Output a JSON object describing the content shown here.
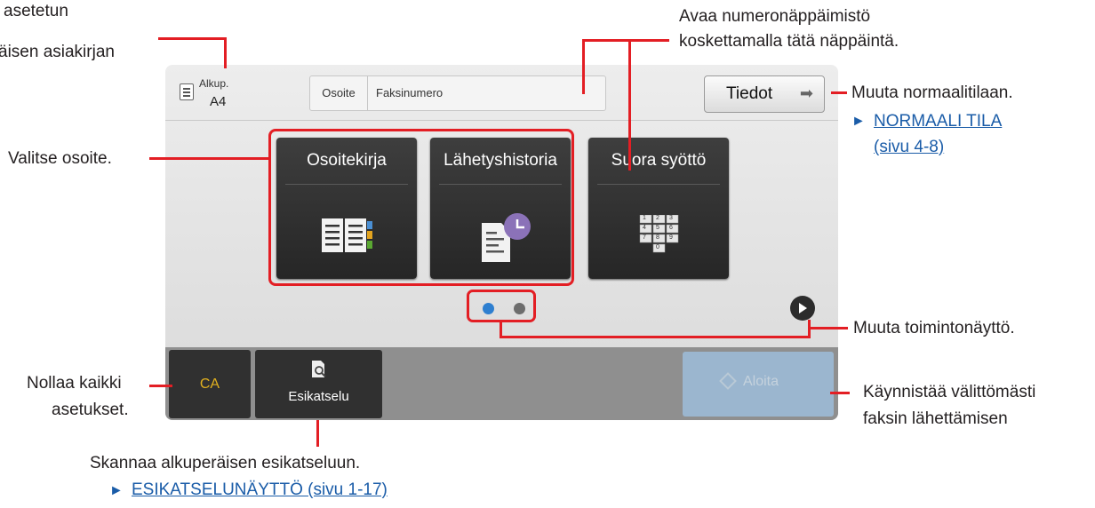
{
  "panel": {
    "original": {
      "label": "Alkup.",
      "size": "A4"
    },
    "address": {
      "label": "Osoite",
      "placeholder": "Faksinumero"
    },
    "details_button": "Tiedot",
    "tiles": [
      {
        "label": "Osoitekirja",
        "icon": "address-book-icon"
      },
      {
        "label": "Lähetyshistoria",
        "icon": "send-history-icon"
      },
      {
        "label": "Suora syöttö",
        "icon": "keypad-icon"
      }
    ],
    "keypad_keys": [
      "1",
      "2",
      "3",
      "4",
      "5",
      "6",
      "7",
      "8",
      "9",
      "0"
    ],
    "page_dots": {
      "count": 2,
      "active": 0,
      "active_color": "#2e7fd0",
      "inactive_color": "#6d6d6d"
    },
    "bottom": {
      "ca": "CA",
      "preview": "Esikatselu",
      "start": "Aloita"
    }
  },
  "annotations": {
    "original_line1": "asetetun",
    "original_line2": "äisen asiakirjan",
    "keypad_line1": "Avaa numeronäppäimistö",
    "keypad_line2": "koskettamalla tätä näppäintä.",
    "normal_mode": "Muuta normaalitilaan.",
    "normal_link_line1": "NORMAALI TILA",
    "normal_link_line2": "(sivu 4-8)",
    "select_address": "Valitse osoite.",
    "change_screen": "Muuta toimintonäyttö.",
    "reset_line1": "Nollaa kaikki",
    "reset_line2": "asetukset.",
    "start_line1": "Käynnistää välittömästi",
    "start_line2": "faksin lähettämisen",
    "preview_desc": "Skannaa alkuperäisen esikatseluun.",
    "preview_link": "ESIKATSELUNÄYTTÖ (sivu 1-17)"
  },
  "colors": {
    "callout": "#e31e24",
    "link": "#1a5ca8",
    "ca_text": "#e3b21f"
  }
}
